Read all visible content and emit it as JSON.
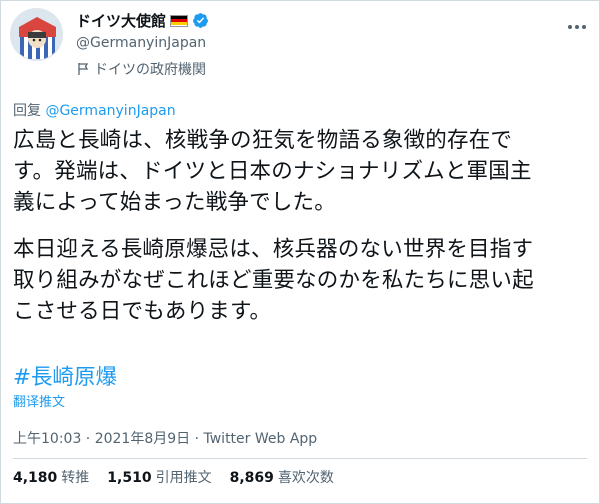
{
  "account": {
    "name": "ドイツ大使館",
    "handle": "@GermanyinJapan",
    "label": "ドイツの政府機関",
    "flag_colors": [
      "#000000",
      "#dd0000",
      "#ffce00"
    ],
    "verified_color": "#1d9bf0"
  },
  "more_icon": "more-horizontal-icon",
  "reply": {
    "prefix": "回复 ",
    "mention": "@GermanyinJapan"
  },
  "tweet": {
    "paragraph1": "広島と長崎は、核戦争の狂気を物語る象徴的存在で\nす。発端は、ドイツと日本のナショナリズムと軍国主\n義によって始まった戦争でした。",
    "paragraph2": "本日迎える長崎原爆忌は、核兵器のない世界を目指す\n取り組みがなぜこれほど重要なのかを私たちに思い起\nこさせる日でもあります。",
    "hashtag": "#長崎原爆",
    "translate": "翻译推文"
  },
  "meta": {
    "text": "上午10:03 · 2021年8月9日 · Twitter Web App"
  },
  "stats": {
    "retweets": {
      "count": "4,180",
      "label": "转推"
    },
    "quotes": {
      "count": "1,510",
      "label": "引用推文"
    },
    "likes": {
      "count": "8,869",
      "label": "喜欢次数"
    }
  }
}
